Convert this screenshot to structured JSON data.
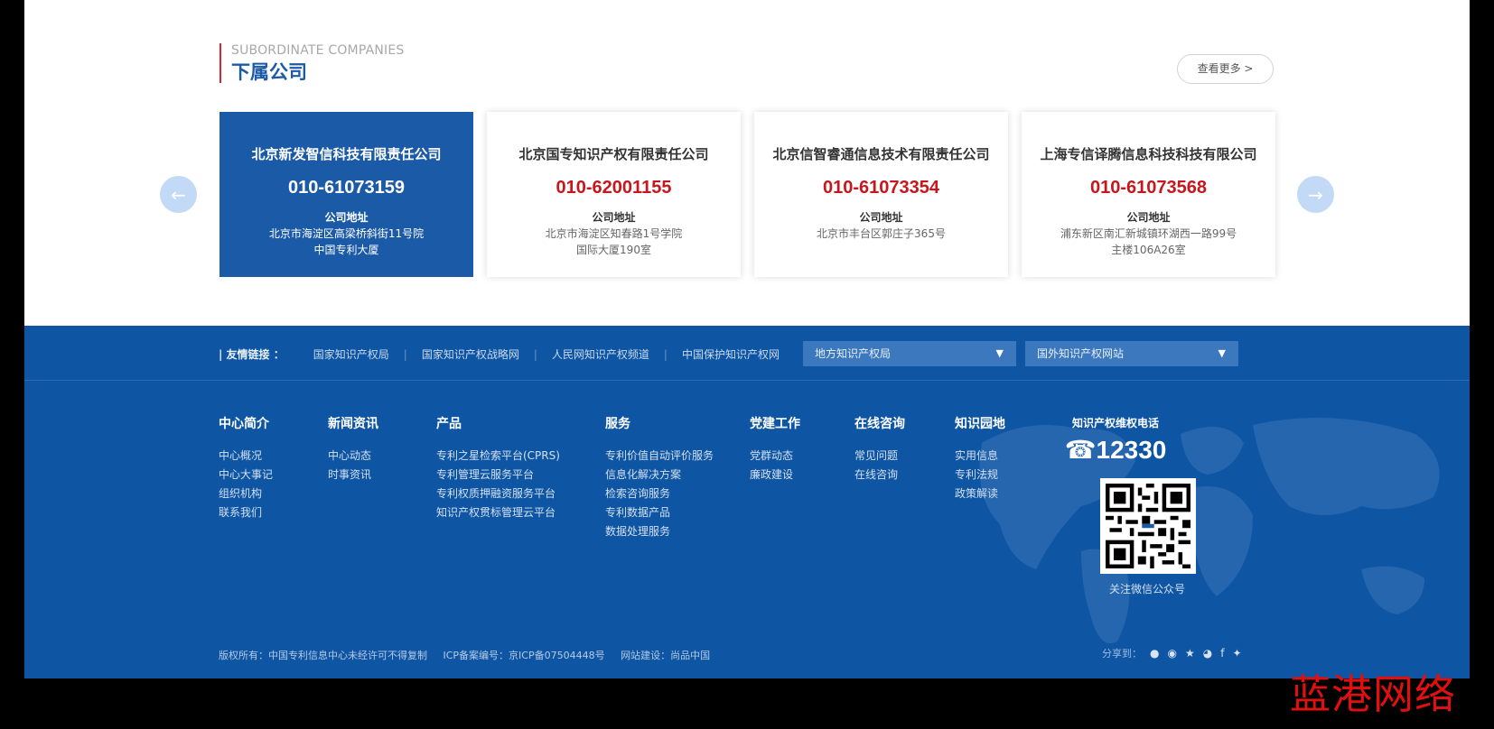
{
  "section": {
    "en_title": "SUBORDINATE COMPANIES",
    "cn_title": "下属公司",
    "more": "查看更多 >"
  },
  "cards": [
    {
      "name": "北京新发智信科技有限责任公司",
      "phone": "010-61073159",
      "addr_label": "公司地址",
      "addr1": "北京市海淀区高梁桥斜街11号院",
      "addr2": "中国专利大厦"
    },
    {
      "name": "北京国专知识产权有限责任公司",
      "phone": "010-62001155",
      "addr_label": "公司地址",
      "addr1": "北京市海淀区知春路1号学院",
      "addr2": "国际大厦190室"
    },
    {
      "name": "北京信智睿通信息技术有限责任公司",
      "phone": "010-61073354",
      "addr_label": "公司地址",
      "addr1": "北京市丰台区郭庄子365号",
      "addr2": ""
    },
    {
      "name": "上海专信译腾信息科技科技有限公司",
      "phone": "010-61073568",
      "addr_label": "公司地址",
      "addr1": "浦东新区南汇新城镇环湖西一路99号",
      "addr2": "主楼106A26室"
    }
  ],
  "friend_links": {
    "label": "| 友情链接 ：",
    "items": [
      "国家知识产权局",
      "国家知识产权战略网",
      "人民网知识产权频道",
      "中国保护知识产权网"
    ],
    "select1": "地方知识产权局",
    "select2": "国外知识产权网站"
  },
  "footer_cols": [
    {
      "title": "中心简介",
      "items": [
        "中心概况",
        "中心大事记",
        "组织机构",
        "联系我们"
      ]
    },
    {
      "title": "新闻资讯",
      "items": [
        "中心动态",
        "时事资讯"
      ]
    },
    {
      "title": "产品",
      "items": [
        "专利之星检索平台(CPRS)",
        "专利管理云服务平台",
        "专利权质押融资服务平台",
        "知识产权贯标管理云平台"
      ]
    },
    {
      "title": "服务",
      "items": [
        "专利价值自动评价服务",
        "信息化解决方案",
        "检索咨询服务",
        "专利数据产品",
        "数据处理服务"
      ]
    },
    {
      "title": "党建工作",
      "items": [
        "党群动态",
        "廉政建设"
      ]
    },
    {
      "title": "在线咨询",
      "items": [
        "常见问题",
        "在线咨询"
      ]
    },
    {
      "title": "知识园地",
      "items": [
        "实用信息",
        "专利法规",
        "政策解读"
      ]
    }
  ],
  "hotline": {
    "title": "知识产权维权电话",
    "number": "12330",
    "qr_caption": "关注微信公众号"
  },
  "copyright": {
    "c1": "版权所有：中国专利信息中心未经许可不得复制",
    "c2": "ICP备案编号：京ICP备07504448号",
    "c3": "网站建设：尚品中国"
  },
  "share": {
    "label": "分享到："
  },
  "watermark": "蓝港网络",
  "colors": {
    "brand_blue": "#1b5aa6",
    "footer_blue": "#0e55a3",
    "phone_red": "#c8161d"
  }
}
